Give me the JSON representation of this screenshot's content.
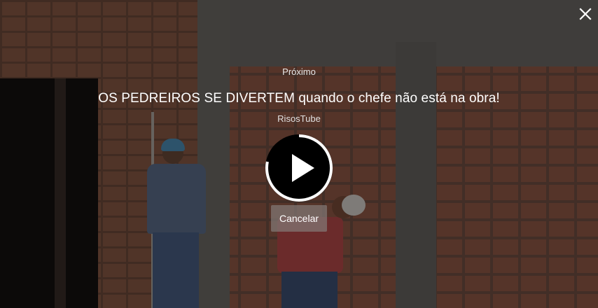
{
  "endscreen": {
    "next_label": "Próximo",
    "video_title": "OS PEDREIROS SE DIVERTEM quando o chefe não está na obra!",
    "channel_name": "RisosTube",
    "cancel_label": "Cancelar",
    "countdown_progress": 0.78
  },
  "icons": {
    "close": "close-icon",
    "play": "play-icon"
  },
  "colors": {
    "overlay_text": "#ffffff",
    "progress_ring": "#ffffff",
    "play_circle": "#000000"
  }
}
